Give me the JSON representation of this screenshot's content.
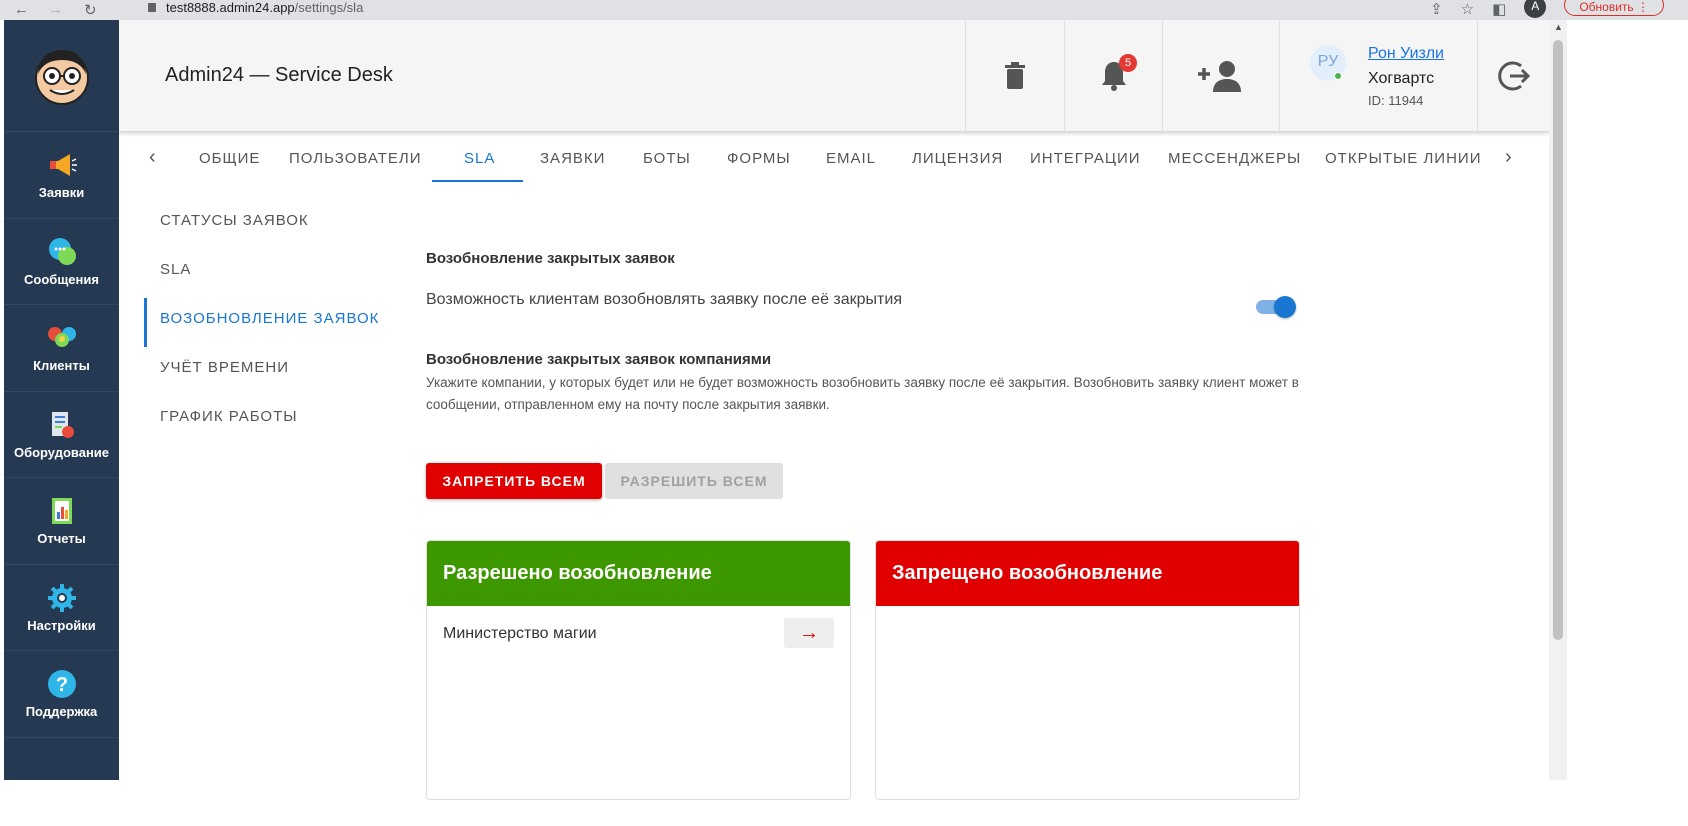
{
  "browser": {
    "url_host": "test8888.admin24.app",
    "url_path": "/settings/sla",
    "profile_initial": "A",
    "update_label": "Обновить"
  },
  "header": {
    "title": "Admin24 — Service Desk",
    "notifications_count": "5",
    "user": {
      "initials": "РУ",
      "name": "Рон Уизли",
      "org": "Хогвартс",
      "id": "ID: 11944"
    }
  },
  "sidebar": {
    "items": [
      {
        "label": "Заявки",
        "icon": "megaphone-icon"
      },
      {
        "label": "Сообщения",
        "icon": "chat-bubbles-icon"
      },
      {
        "label": "Клиенты",
        "icon": "people-icon"
      },
      {
        "label": "Оборудование",
        "icon": "equipment-icon"
      },
      {
        "label": "Отчеты",
        "icon": "report-icon"
      },
      {
        "label": "Настройки",
        "icon": "gear-icon"
      },
      {
        "label": "Поддержка",
        "icon": "help-icon"
      }
    ]
  },
  "tabs": [
    "Общие",
    "Пользователи",
    "SLA",
    "Заявки",
    "Боты",
    "Формы",
    "Email",
    "Лицензия",
    "Интеграции",
    "Мессенджеры",
    "Открытые линии"
  ],
  "active_tab": "SLA",
  "subnav": [
    "Статусы заявок",
    "SLA",
    "Возобновление заявок",
    "Учёт времени",
    "График работы"
  ],
  "active_subnav": "Возобновление заявок",
  "content": {
    "section1_title": "Возобновление закрытых заявок",
    "section1_text": "Возможность клиентам возобновлять заявку после её закрытия",
    "toggle_on": true,
    "section2_title": "Возобновление закрытых заявок компаниями",
    "section2_text": "Укажите компании, у которых будет или не будет возможность возобновить заявку после её закрытия. Возобновить заявку клиент может в сообщении, отправленном ему на почту после закрытия заявки.",
    "deny_all": "Запретить всем",
    "allow_all": "Разрешить всем",
    "allowed_panel_title": "Разрешено возобновление",
    "denied_panel_title": "Запрещено возобновление",
    "allowed_companies": [
      "Министерство магии"
    ],
    "colors": {
      "allowed": "#3d9800",
      "denied": "#e00000",
      "accent": "#1976d2"
    }
  }
}
